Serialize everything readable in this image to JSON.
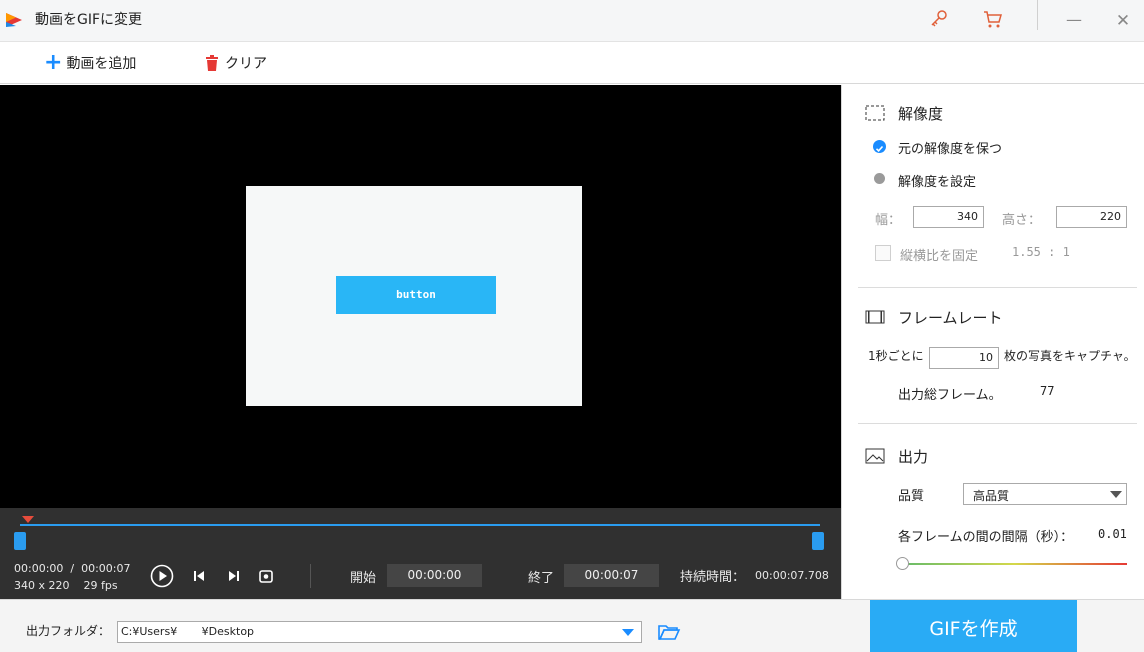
{
  "window": {
    "title": "動画をGIFに変更",
    "icons": [
      "app-logo-icon",
      "key-icon",
      "cart-icon",
      "minimize-icon",
      "close-icon"
    ],
    "minimize_glyph": "—",
    "close_glyph": "✕"
  },
  "toolbar": {
    "add_video_label": "動画を追加",
    "clear_label": "クリア"
  },
  "preview": {
    "frame_button_label": "button"
  },
  "player": {
    "time_readout": "00:00:00  /  00:00:07",
    "resolution_readout": "340 x 220    29 fps",
    "start_label": "開始",
    "start_value": "00:00:00",
    "end_label": "終了",
    "end_value": "00:00:07",
    "duration_label": "持続時間：",
    "duration_value": "00:00:07.708"
  },
  "resolution": {
    "title": "解像度",
    "keep_original_label": "元の解像度を保つ",
    "set_custom_label": "解像度を設定",
    "width_label": "幅：",
    "width_value": "340",
    "height_label": "高さ：",
    "height_value": "220",
    "lock_ratio_label": "縦横比を固定",
    "ratio_value": "1.55 : 1"
  },
  "framerate": {
    "title": "フレームレート",
    "per_second_label": "1秒ごとに",
    "per_second_value": "10",
    "capture_suffix": "枚の写真をキャプチャ。",
    "total_frames_label": "出力総フレーム。",
    "total_frames_value": "77"
  },
  "output": {
    "title": "出力",
    "quality_label": "品質",
    "quality_value": "高品質",
    "interval_label": "各フレームの間の間隔（秒）：",
    "interval_value": "0.01"
  },
  "bottom": {
    "output_folder_label": "出力フォルダ：",
    "output_path": "C:¥Users¥       ¥Desktop",
    "create_gif_label": "GIFを作成"
  },
  "colors": {
    "accent": "#29abf5",
    "timeline": "#2a9cf0",
    "playhead": "#e74c3c",
    "delete_red": "#e53935"
  }
}
